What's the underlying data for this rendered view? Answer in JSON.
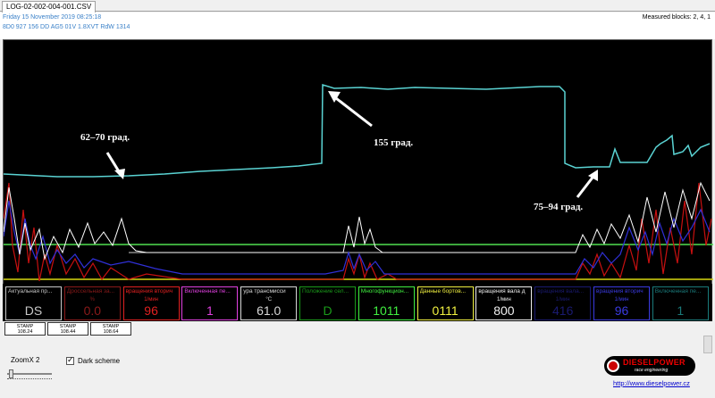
{
  "tab": {
    "label": "LOG-02-002-004-001.CSV"
  },
  "header": {
    "date": "Friday 15 November 2019 08:25:18",
    "ecu": "8D0 927 156 DD  AG5 01V 1.8ХVТ RdW 1314",
    "measured_blocks": "Measured blocks: 2, 4, 1"
  },
  "annotations": {
    "a1": "62–70 град.",
    "a2": "155 град.",
    "a3": "75–94 град."
  },
  "colors": {
    "cyan": "#5ad3d3",
    "white": "#ffffff",
    "red": "#c81010",
    "blue": "#3030d8",
    "green": "#50e050",
    "yellow": "#d8d810"
  },
  "blocks": [
    {
      "label": "Актуальная пр...",
      "unit": "",
      "value": "DS",
      "color": "#c8c8c8"
    },
    {
      "label": "Дроссельная за...",
      "unit": "%",
      "value": "0.0",
      "color": "#8b1a1a"
    },
    {
      "label": "вращения вторич",
      "unit": "1/мин",
      "value": "96",
      "color": "#e02020"
    },
    {
      "label": "Включенная пе...",
      "unit": "",
      "value": "1",
      "color": "#e040e0"
    },
    {
      "label": "ура трансмисси",
      "unit": "°C",
      "value": "61.0",
      "color": "#d8d8d8"
    },
    {
      "label": "Положение сел...",
      "unit": "",
      "value": "D",
      "color": "#1a9a1a"
    },
    {
      "label": "Многофункцион...",
      "unit": "",
      "value": "1011",
      "color": "#40f040"
    },
    {
      "label": "Данные бортов...",
      "unit": "",
      "value": "0111",
      "color": "#f0f040"
    },
    {
      "label": "вращения вала д",
      "unit": "1/мин",
      "value": "800",
      "color": "#f0f0f0"
    },
    {
      "label": "вращения вала...",
      "unit": "1/мин",
      "value": "416",
      "color": "#1a1a70"
    },
    {
      "label": "вращения вторич",
      "unit": "1/мин",
      "value": "96",
      "color": "#3a3ae0"
    },
    {
      "label": "Включенная пе...",
      "unit": "",
      "value": "1",
      "color": "#1a7a7a"
    }
  ],
  "stamps": [
    {
      "title": "STAMP",
      "value": "108.24"
    },
    {
      "title": "STAMP",
      "value": "108.44"
    },
    {
      "title": "STAMP",
      "value": "108.64"
    }
  ],
  "zoom": {
    "label": "ZoomX 2"
  },
  "dark_scheme": {
    "label": "Dark scheme",
    "checked": true,
    "check_glyph": "✓"
  },
  "logo": {
    "name": "DIESELPOWER",
    "sub": "race engineering"
  },
  "link": {
    "text": "http://www.dieselpower.cz"
  }
}
